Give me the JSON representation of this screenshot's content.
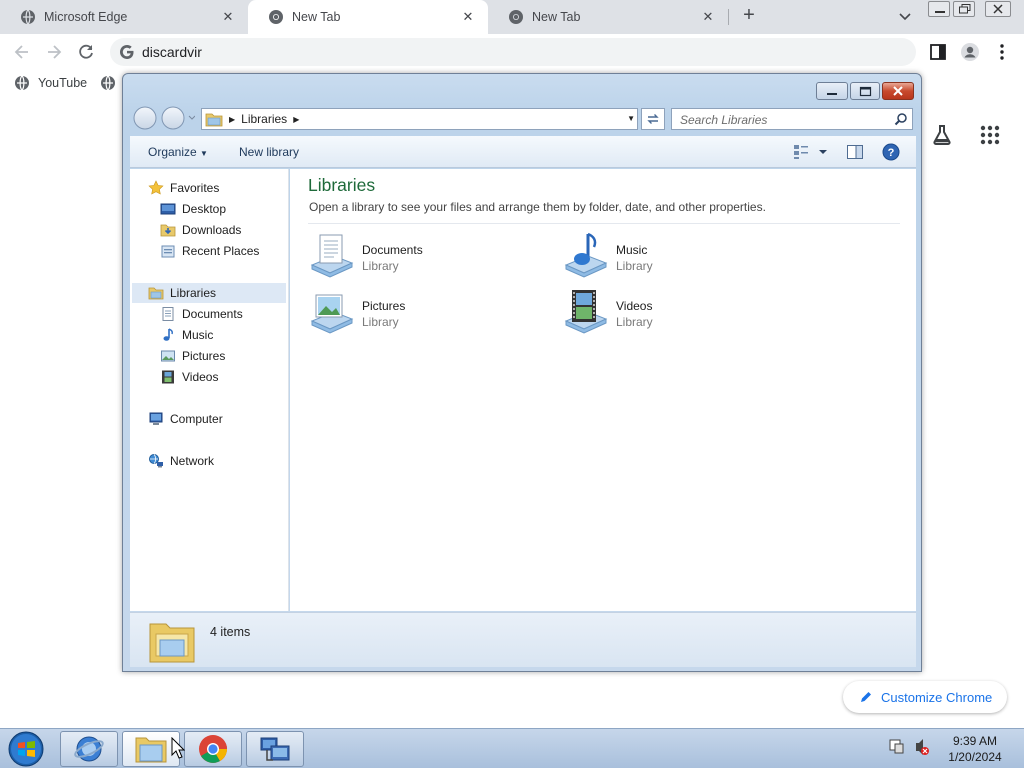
{
  "browser": {
    "tabs": [
      {
        "title": "Microsoft Edge",
        "active": false
      },
      {
        "title": "New Tab",
        "active": true
      },
      {
        "title": "New Tab",
        "active": false
      }
    ],
    "address": "discardvir",
    "bookmarks": [
      {
        "label": "YouTube"
      }
    ],
    "customize_label": "Customize Chrome"
  },
  "explorer": {
    "breadcrumb": "Libraries",
    "search_placeholder": "Search Libraries",
    "commands": {
      "organize": "Organize",
      "new_library": "New library"
    },
    "nav": {
      "favorites": {
        "label": "Favorites",
        "items": [
          "Desktop",
          "Downloads",
          "Recent Places"
        ]
      },
      "libraries": {
        "label": "Libraries",
        "items": [
          "Documents",
          "Music",
          "Pictures",
          "Videos"
        ]
      },
      "computer": "Computer",
      "network": "Network"
    },
    "content": {
      "title": "Libraries",
      "subtitle": "Open a library to see your files and arrange them by folder, date, and other properties.",
      "libraries": [
        {
          "name": "Documents",
          "type": "Library"
        },
        {
          "name": "Music",
          "type": "Library"
        },
        {
          "name": "Pictures",
          "type": "Library"
        },
        {
          "name": "Videos",
          "type": "Library"
        }
      ]
    },
    "status": "4 items"
  },
  "taskbar": {
    "time": "9:39 AM",
    "date": "1/20/2024"
  }
}
